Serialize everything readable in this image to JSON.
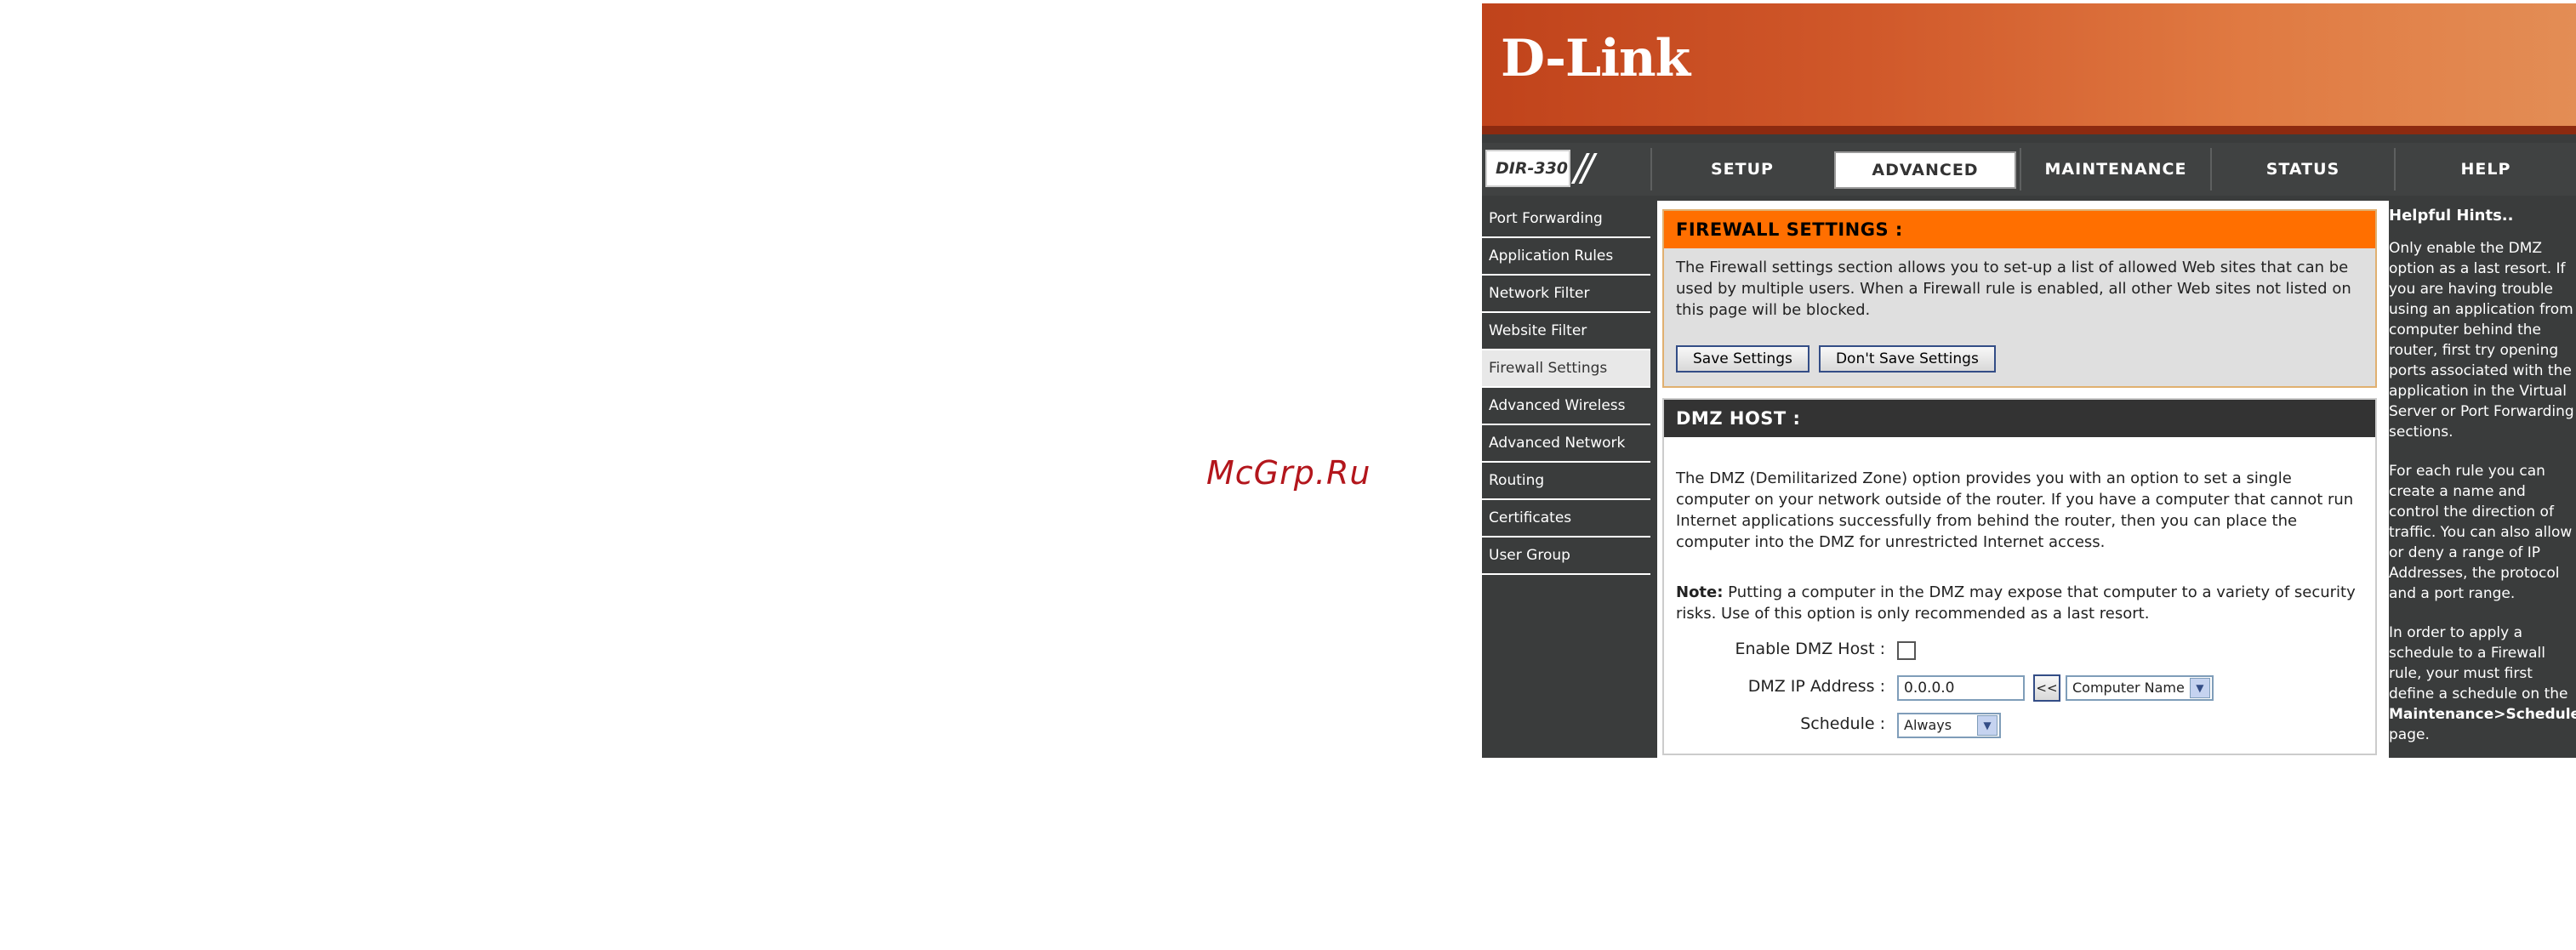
{
  "watermark": "McGrp.Ru",
  "brand": {
    "logo": "D-Link",
    "model": "DIR-330",
    "accent": "#ff6f00"
  },
  "nav": {
    "tabs": [
      {
        "label": "SETUP"
      },
      {
        "label": "ADVANCED"
      },
      {
        "label": "MAINTENANCE"
      },
      {
        "label": "STATUS"
      },
      {
        "label": "HELP"
      }
    ],
    "active_tab": "ADVANCED"
  },
  "sidebar": {
    "items": [
      {
        "label": "Port Forwarding"
      },
      {
        "label": "Application Rules"
      },
      {
        "label": "Network Filter"
      },
      {
        "label": "Website Filter"
      },
      {
        "label": "Firewall Settings"
      },
      {
        "label": "Advanced Wireless"
      },
      {
        "label": "Advanced Network"
      },
      {
        "label": "Routing"
      },
      {
        "label": "Certificates"
      },
      {
        "label": "User Group"
      }
    ],
    "active_item": "Firewall Settings"
  },
  "firewall": {
    "title": "FIREWALL SETTINGS :",
    "description": "The Firewall settings section allows you to set-up a list of allowed Web sites that can be used by multiple users. When a Firewall rule is enabled, all other Web sites not listed on this page will be blocked.",
    "save_label": "Save Settings",
    "dont_save_label": "Don't Save Settings"
  },
  "dmz": {
    "title": "DMZ HOST :",
    "description": "The DMZ (Demilitarized Zone) option provides you with an option to set a single computer on your network outside of the router. If you have a computer that cannot run Internet applications successfully from behind the router, then you can place the computer into the DMZ for unrestricted Internet access.",
    "note_label": "Note:",
    "note_text": " Putting a computer in the DMZ may expose that computer to a variety of security risks. Use of this option is only recommended as a last resort.",
    "enable_label": "Enable DMZ Host :",
    "enable_checked": false,
    "ip_label": "DMZ IP Address :",
    "ip_value": "0.0.0.0",
    "copy_button": "<<",
    "computer_select": "Computer Name",
    "schedule_label": "Schedule :",
    "schedule_value": "Always"
  },
  "hints": {
    "title": "Helpful Hints..",
    "p1": "Only enable the DMZ option as a last resort. If you are having trouble using an application from computer behind the router, first try opening ports associated with the application in the Virtual Server or Port Forwarding sections.",
    "p2": "For each rule you can create a name and control the direction of traffic. You can also allow or deny a range of IP Addresses, the protocol and a port range.",
    "p3_before": "In order to apply a schedule to a Firewall rule, your must first define a schedule on the ",
    "p3_link": "Maintenance>Schedules",
    "p3_after": " page."
  }
}
